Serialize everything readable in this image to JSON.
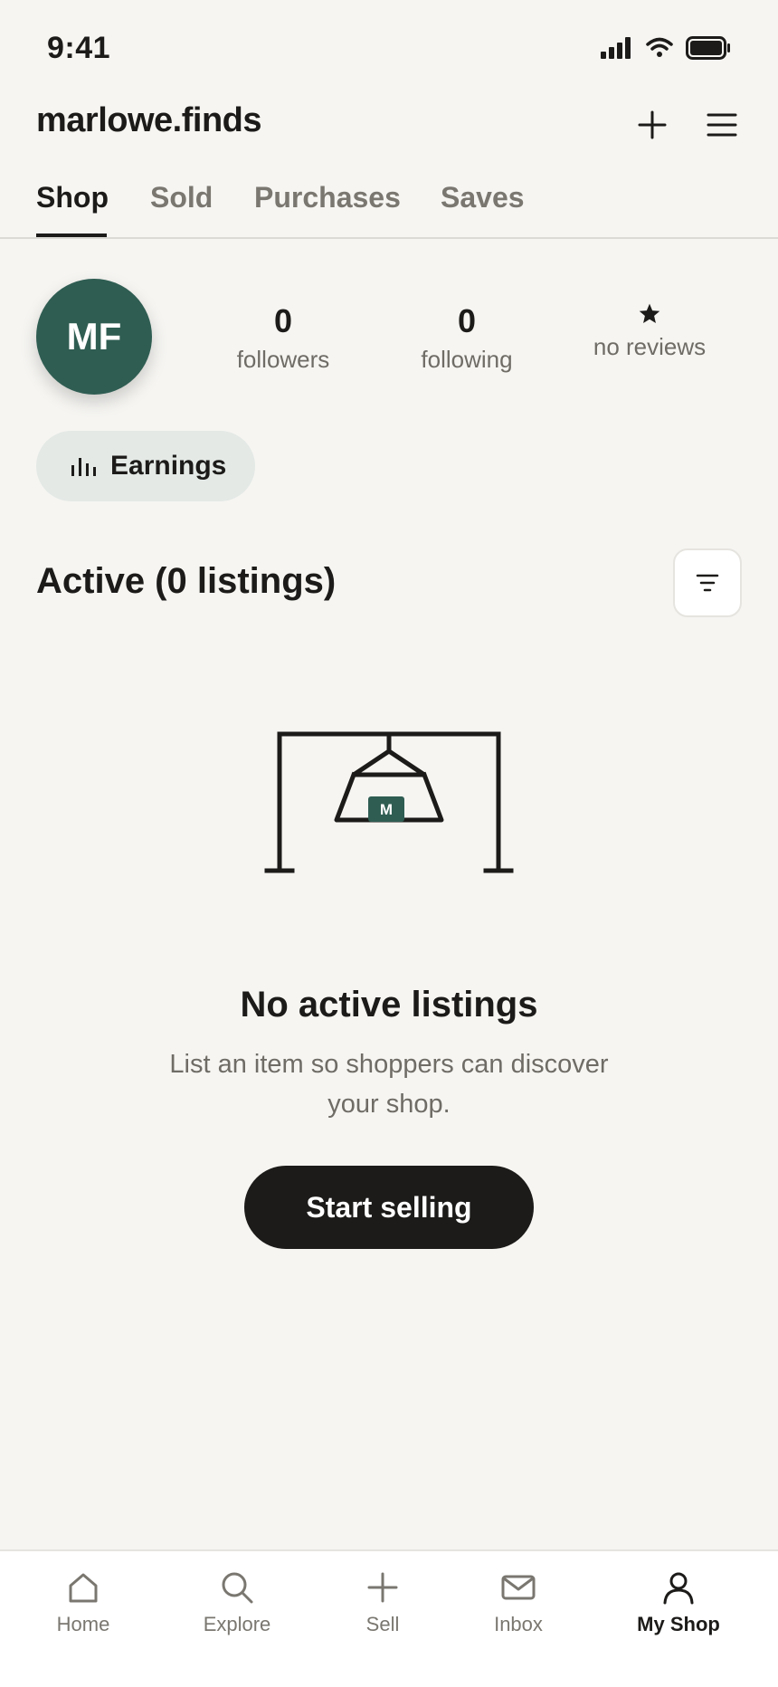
{
  "status_bar": {
    "time": "9:41"
  },
  "header": {
    "username": "marlowe.finds"
  },
  "tabs": [
    {
      "label": "Shop",
      "active": true
    },
    {
      "label": "Sold",
      "active": false
    },
    {
      "label": "Purchases",
      "active": false
    },
    {
      "label": "Saves",
      "active": false
    }
  ],
  "profile": {
    "initials": "MF",
    "avatar_color": "#2f5d52",
    "followers": {
      "count": "0",
      "label": "followers"
    },
    "following": {
      "count": "0",
      "label": "following"
    },
    "reviews": {
      "label": "no reviews"
    }
  },
  "earnings_button": {
    "label": "Earnings"
  },
  "listings": {
    "section_title": "Active (0 listings)",
    "empty_title": "No active listings",
    "empty_description": "List an item so shoppers can discover your shop.",
    "illustration_tag": "M",
    "cta_label": "Start selling"
  },
  "bottom_nav": [
    {
      "label": "Home",
      "icon": "home-icon",
      "active": false
    },
    {
      "label": "Explore",
      "icon": "search-icon",
      "active": false
    },
    {
      "label": "Sell",
      "icon": "plus-icon",
      "active": false
    },
    {
      "label": "Inbox",
      "icon": "mail-icon",
      "active": false
    },
    {
      "label": "My Shop",
      "icon": "person-icon",
      "active": true
    }
  ],
  "colors": {
    "accent": "#2f5d52",
    "background": "#f6f5f2",
    "text": "#1c1b19"
  }
}
